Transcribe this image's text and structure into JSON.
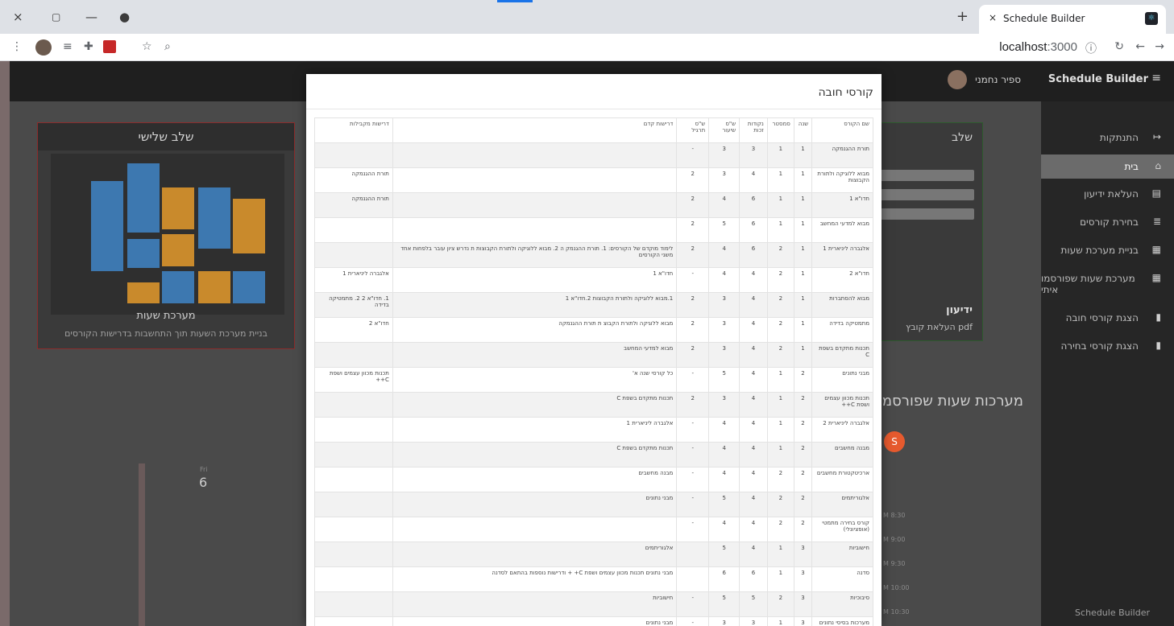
{
  "browser": {
    "tab_title": "Schedule Builder",
    "tab_close": "×",
    "new_tab": "+",
    "url_host": "localhost",
    "url_port": ":3000",
    "window_close": "×",
    "window_restore": "▢",
    "window_minimize": "—"
  },
  "header": {
    "brand": "Schedule Builder",
    "user_name": "ספיר נחמני"
  },
  "sidebar": {
    "items": [
      {
        "label": "התנתקות",
        "icon": "logout-icon",
        "glyph": "↦"
      },
      {
        "label": "בית",
        "icon": "home-icon",
        "glyph": "⌂",
        "active": true
      },
      {
        "label": "העלאת ידיעון",
        "icon": "file-upload-icon",
        "glyph": "▤"
      },
      {
        "label": "בחירת קורסים",
        "icon": "list-icon",
        "glyph": "≣"
      },
      {
        "label": "בניית מערכת שעות",
        "icon": "calendar-icon",
        "glyph": "▦"
      },
      {
        "label": "מערכת שעות שפורסמו איתי",
        "icon": "calendar-shared-icon",
        "glyph": "▦"
      },
      {
        "label": "הצגת קורסי חובה",
        "icon": "bookmark-icon",
        "glyph": "▮"
      },
      {
        "label": "הצגת קורסי בחירה",
        "icon": "bookmark-icon",
        "glyph": "▮"
      }
    ],
    "footer": "Schedule Builder"
  },
  "left_card": {
    "title": "שלב שלישי",
    "caption": "מערכת שעות",
    "subtitle": "בניית מערכת השעות תוך התחשבות בדרישות הקורסים"
  },
  "right_card": {
    "title": "שלב",
    "upload_title": "ידיעון",
    "upload_sub": "העלאת קובץ pdf"
  },
  "background": {
    "heading": "מערכות שעות שפורסמו",
    "avatar_letter": "S",
    "day_label": "Fri",
    "day_num": "6",
    "times": [
      "M 8:30",
      "M 9:00",
      "M 9:30",
      "M 10:00",
      "M 10:30"
    ]
  },
  "modal": {
    "title": "קורסי חובה",
    "columns": [
      "שם הקורס",
      "שנה",
      "סמסטר",
      "נקודות זכות",
      "ש\"ס שיעור",
      "ש\"ס תרגיל",
      "דרישות קדם",
      "דרישות מקבילות"
    ],
    "rows": [
      [
        "תורת ההגנמקה",
        "1",
        "1",
        "3",
        "3",
        "-",
        "",
        ""
      ],
      [
        "מבוא ללוגיקה ולתורת הקבוצות",
        "1",
        "1",
        "4",
        "3",
        "2",
        "",
        "תורת ההגנמקה"
      ],
      [
        "חדו\"א 1",
        "1",
        "1",
        "6",
        "4",
        "2",
        "",
        "תורת ההגנמקה"
      ],
      [
        "מבוא למדעי המחשב",
        "1",
        "1",
        "6",
        "5",
        "2",
        "",
        ""
      ],
      [
        "אלגברה ליניארית 1",
        "1",
        "2",
        "6",
        "4",
        "2",
        "לימוד מוקדם של הקורסים: 1. תורת ההגנמק ה 2. מבוא ללוגיקה ולתורת הקבוצות ת נדרש ציון עובר בלפחות אחד משני הקורסים",
        ""
      ],
      [
        "חדו\"א 2",
        "1",
        "2",
        "4",
        "4",
        "-",
        "חדו\"א 1",
        "אלגברה ליניארית 1"
      ],
      [
        "מבוא להסתברות",
        "1",
        "2",
        "4",
        "3",
        "2",
        "1.מבוא ללוגיקה ולתורת הקבוצות 2.חדו\"א 1",
        "1. חדו\"א 2 2. מתמטיקה בדידה"
      ],
      [
        "מתמטיקה בדידה",
        "1",
        "2",
        "4",
        "3",
        "2",
        "מבוא ללוגיקה ולתורת הקבוצ ת תורת ההגנמקה",
        "חדו\"א 2"
      ],
      [
        "תכנות מתקדם בשפת C",
        "1",
        "2",
        "4",
        "3",
        "2",
        "מבוא למדעי המחשב",
        ""
      ],
      [
        "מבני נתונים",
        "2",
        "1",
        "4",
        "5",
        "-",
        "כל קורסי שנה א'",
        "תכנות מכוון עצמים ושפת C++"
      ],
      [
        "תכנות מכוון עצמים ושפת C++",
        "2",
        "1",
        "4",
        "3",
        "2",
        "תכנות מתקדם בשפת C",
        ""
      ],
      [
        "אלגברה ליניארית 2",
        "2",
        "1",
        "4",
        "4",
        "-",
        "אלגברה ליניארית 1",
        ""
      ],
      [
        "מבנה מחשבים",
        "2",
        "1",
        "4",
        "4",
        "-",
        "תכנות מתקדם בשפת C",
        ""
      ],
      [
        "ארכיטקטורת מחשבים",
        "2",
        "2",
        "4",
        "4",
        "-",
        "מבנה מחשבים",
        ""
      ],
      [
        "אלגוריתמים",
        "2",
        "2",
        "4",
        "5",
        "-",
        "מבני נתונים",
        ""
      ],
      [
        "קורס בחירה מתמטי (אופציונלי)",
        "2",
        "2",
        "4",
        "4",
        "-",
        "",
        ""
      ],
      [
        "חישוביות",
        "3",
        "1",
        "4",
        "5",
        "",
        "אלגוריתמים",
        ""
      ],
      [
        "סדנה",
        "3",
        "1",
        "6",
        "6",
        "",
        "מבני נתונים תכנות מכוון עצמים ושפת C+ + ודרישות נוספות בהתאם לסדנה",
        ""
      ],
      [
        "סיבוכיות",
        "3",
        "2",
        "5",
        "5",
        "-",
        "חישוביות",
        ""
      ],
      [
        "מערכות בסיסי נתונים",
        "3",
        "1",
        "3",
        "3",
        "-",
        "מבני נתונים",
        ""
      ]
    ]
  }
}
